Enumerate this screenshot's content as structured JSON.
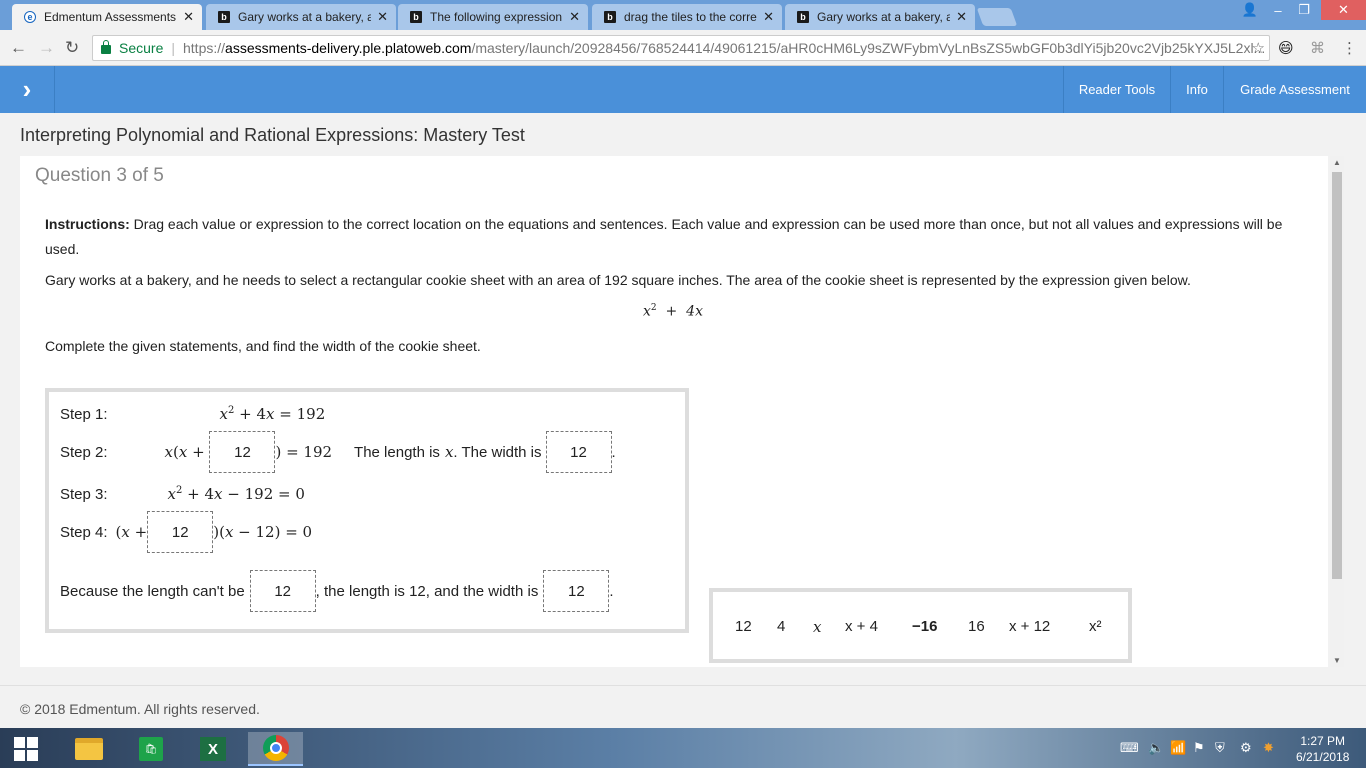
{
  "browser": {
    "tabs": [
      {
        "title": "Edmentum Assessments",
        "active": true
      },
      {
        "title": "Gary works at a bakery, an",
        "active": false
      },
      {
        "title": "The following expression",
        "active": false
      },
      {
        "title": "drag the tiles to the corre",
        "active": false
      },
      {
        "title": "Gary works at a bakery, a",
        "active": false
      }
    ],
    "secure_label": "Secure",
    "url_scheme": "https://",
    "url_host": "assessments-delivery.ple.platoweb.com",
    "url_path": "/mastery/launch/20928456/768524414/49061215/aHR0cHM6Ly9sZWFybmVyLnBsZS5wbGF0b3dlYi5jb20vc2Vjb25kYXJ5L2xl..."
  },
  "header": {
    "links": [
      "Reader Tools",
      "Info",
      "Grade Assessment"
    ]
  },
  "test_title": "Interpreting Polynomial and Rational Expressions: Mastery Test",
  "question_label": "Question 3 of 5",
  "instructions_label": "Instructions:",
  "instructions_text": " Drag each value or expression to the correct location on the equations and sentences. Each value and expression can be used more than once, but not all values and expressions will be used.",
  "problem_text": "Gary works at a bakery, and he needs to select a rectangular cookie sheet with an area of 192 square inches. The area of the cookie sheet is represented by the expression given below.",
  "complete_text": "Complete the given statements, and find the width of the cookie sheet.",
  "steps": {
    "step1_label": "Step 1:",
    "step2_label": "Step 2:",
    "step3_label": "Step 3:",
    "step4_label": "Step 4:",
    "length_text": "The length is",
    "width_text": ". The width is",
    "because_text": "Because the length can't be",
    "length_is_text": ", the length is 12, and the width is",
    "slot_step2": "12",
    "slot_width": "12",
    "slot_step4": "12",
    "slot_cant_be": "12",
    "slot_width_final": "12"
  },
  "tiles": [
    "12",
    "4",
    "x",
    "x + 4",
    "−16",
    "16",
    "x + 12",
    "x²"
  ],
  "footer": "© 2018 Edmentum. All rights reserved.",
  "clock": {
    "time": "1:27 PM",
    "date": "6/21/2018"
  }
}
